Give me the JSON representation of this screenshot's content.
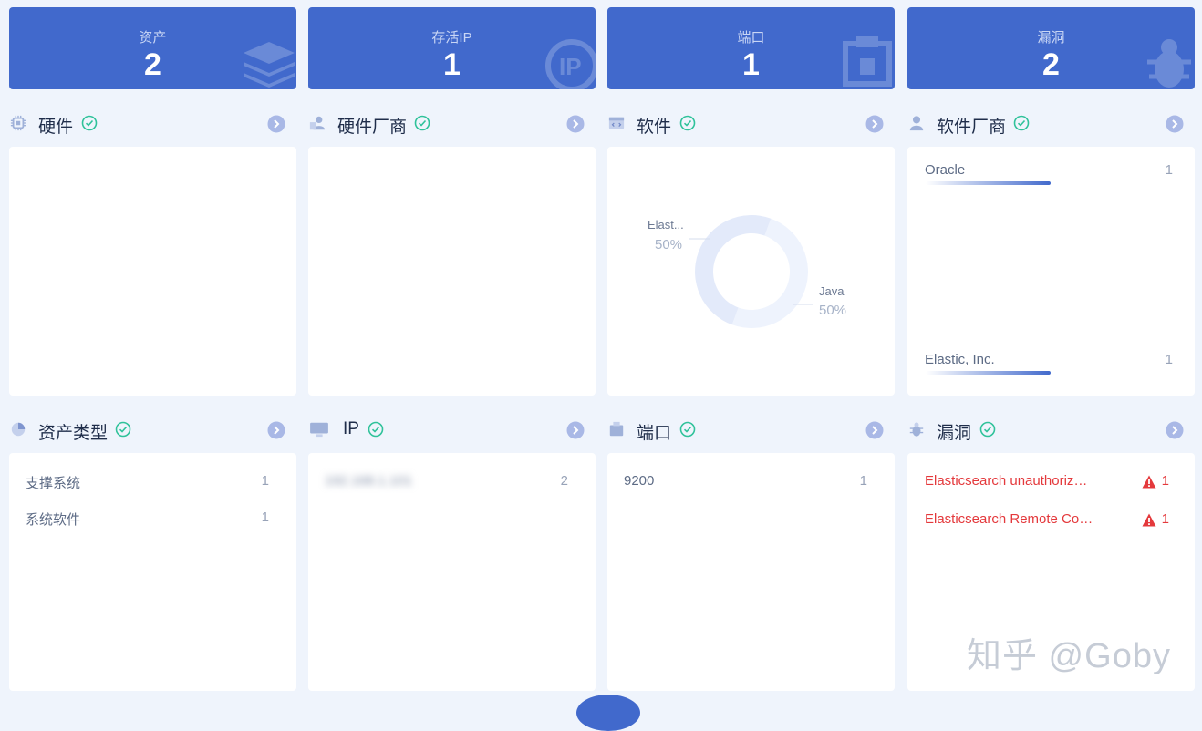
{
  "stats": [
    {
      "label": "资产",
      "value": "2",
      "icon": "layers-icon"
    },
    {
      "label": "存活IP",
      "value": "1",
      "icon": "ip-icon"
    },
    {
      "label": "端口",
      "value": "1",
      "icon": "port-icon"
    },
    {
      "label": "漏洞",
      "value": "2",
      "icon": "bug-icon"
    }
  ],
  "sections": {
    "hardware": {
      "title": "硬件",
      "icon": "chip-icon"
    },
    "hardware_vendor": {
      "title": "硬件厂商",
      "icon": "vendor-icon"
    },
    "software": {
      "title": "软件",
      "icon": "code-window-icon"
    },
    "software_vendor": {
      "title": "软件厂商",
      "icon": "user-icon"
    },
    "asset_type": {
      "title": "资产类型",
      "icon": "pie-icon"
    },
    "ip": {
      "title": "IP",
      "icon": "monitor-icon"
    },
    "port": {
      "title": "端口",
      "icon": "port-icon"
    },
    "vuln": {
      "title": "漏洞",
      "icon": "bug-icon"
    }
  },
  "software_chart": {
    "type": "pie",
    "labels": [
      "Elast...",
      "Java"
    ],
    "values": [
      50,
      50
    ],
    "percent_labels": [
      "50%",
      "50%"
    ]
  },
  "software_vendor_list": [
    {
      "name": "Oracle",
      "count": "1",
      "fraction": 1.0
    },
    {
      "name": "Elastic, Inc.",
      "count": "1",
      "fraction": 1.0
    }
  ],
  "asset_type_list": [
    {
      "name": "支撑系统",
      "count": "1"
    },
    {
      "name": "系统软件",
      "count": "1"
    }
  ],
  "ip_list": [
    {
      "name": "192.168.1.101",
      "count": "2"
    }
  ],
  "port_list": [
    {
      "name": "9200",
      "count": "1"
    }
  ],
  "vuln_list": [
    {
      "name": "Elasticsearch unauthorized access",
      "count": "1"
    },
    {
      "name": "Elasticsearch Remote Code Execution",
      "count": "1"
    }
  ],
  "watermark": "知乎 @Goby",
  "colors": {
    "primary": "#4169cc",
    "check": "#2fc29a",
    "danger": "#e4393c",
    "bg": "#eff4fc"
  }
}
